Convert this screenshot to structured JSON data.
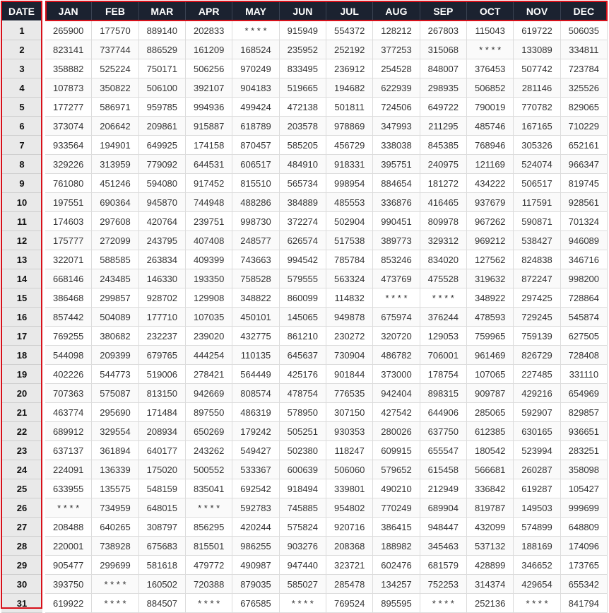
{
  "table": {
    "date_header": "DATE",
    "months": [
      "JAN",
      "FEB",
      "MAR",
      "APR",
      "MAY",
      "JUN",
      "JUL",
      "AUG",
      "SEP",
      "OCT",
      "NOV",
      "DEC"
    ],
    "rows": [
      {
        "date": "1",
        "values": [
          "265900",
          "177570",
          "889140",
          "202833",
          "* * * *",
          "915949",
          "554372",
          "128212",
          "267803",
          "115043",
          "619722",
          "506035"
        ]
      },
      {
        "date": "2",
        "values": [
          "823141",
          "737744",
          "886529",
          "161209",
          "168524",
          "235952",
          "252192",
          "377253",
          "315068",
          "* * * *",
          "133089",
          "334811"
        ]
      },
      {
        "date": "3",
        "values": [
          "358882",
          "525224",
          "750171",
          "506256",
          "970249",
          "833495",
          "236912",
          "254528",
          "848007",
          "376453",
          "507742",
          "723784"
        ]
      },
      {
        "date": "4",
        "values": [
          "107873",
          "350822",
          "506100",
          "392107",
          "904183",
          "519665",
          "194682",
          "622939",
          "298935",
          "506852",
          "281146",
          "325526"
        ]
      },
      {
        "date": "5",
        "values": [
          "177277",
          "586971",
          "959785",
          "994936",
          "499424",
          "472138",
          "501811",
          "724506",
          "649722",
          "790019",
          "770782",
          "829065"
        ]
      },
      {
        "date": "6",
        "values": [
          "373074",
          "206642",
          "209861",
          "915887",
          "618789",
          "203578",
          "978869",
          "347993",
          "211295",
          "485746",
          "167165",
          "710229"
        ]
      },
      {
        "date": "7",
        "values": [
          "933564",
          "194901",
          "649925",
          "174158",
          "870457",
          "585205",
          "456729",
          "338038",
          "845385",
          "768946",
          "305326",
          "652161"
        ]
      },
      {
        "date": "8",
        "values": [
          "329226",
          "313959",
          "779092",
          "644531",
          "606517",
          "484910",
          "918331",
          "395751",
          "240975",
          "121169",
          "524074",
          "966347"
        ]
      },
      {
        "date": "9",
        "values": [
          "761080",
          "451246",
          "594080",
          "917452",
          "815510",
          "565734",
          "998954",
          "884654",
          "181272",
          "434222",
          "506517",
          "819745"
        ]
      },
      {
        "date": "10",
        "values": [
          "197551",
          "690364",
          "945870",
          "744948",
          "488286",
          "384889",
          "485553",
          "336876",
          "416465",
          "937679",
          "117591",
          "928561"
        ]
      },
      {
        "date": "11",
        "values": [
          "174603",
          "297608",
          "420764",
          "239751",
          "998730",
          "372274",
          "502904",
          "990451",
          "809978",
          "967262",
          "590871",
          "701324"
        ]
      },
      {
        "date": "12",
        "values": [
          "175777",
          "272099",
          "243795",
          "407408",
          "248577",
          "626574",
          "517538",
          "389773",
          "329312",
          "969212",
          "538427",
          "946089"
        ]
      },
      {
        "date": "13",
        "values": [
          "322071",
          "588585",
          "263834",
          "409399",
          "743663",
          "994542",
          "785784",
          "853246",
          "834020",
          "127562",
          "824838",
          "346716"
        ]
      },
      {
        "date": "14",
        "values": [
          "668146",
          "243485",
          "146330",
          "193350",
          "758528",
          "579555",
          "563324",
          "473769",
          "475528",
          "319632",
          "872247",
          "998200"
        ]
      },
      {
        "date": "15",
        "values": [
          "386468",
          "299857",
          "928702",
          "129908",
          "348822",
          "860099",
          "114832",
          "* * * *",
          "* * * *",
          "348922",
          "297425",
          "728864"
        ]
      },
      {
        "date": "16",
        "values": [
          "857442",
          "504089",
          "177710",
          "107035",
          "450101",
          "145065",
          "949878",
          "675974",
          "376244",
          "478593",
          "729245",
          "545874"
        ]
      },
      {
        "date": "17",
        "values": [
          "769255",
          "380682",
          "232237",
          "239020",
          "432775",
          "861210",
          "230272",
          "320720",
          "129053",
          "759965",
          "759139",
          "627505"
        ]
      },
      {
        "date": "18",
        "values": [
          "544098",
          "209399",
          "679765",
          "444254",
          "110135",
          "645637",
          "730904",
          "486782",
          "706001",
          "961469",
          "826729",
          "728408"
        ]
      },
      {
        "date": "19",
        "values": [
          "402226",
          "544773",
          "519006",
          "278421",
          "564449",
          "425176",
          "901844",
          "373000",
          "178754",
          "107065",
          "227485",
          "331110"
        ]
      },
      {
        "date": "20",
        "values": [
          "707363",
          "575087",
          "813150",
          "942669",
          "808574",
          "478754",
          "776535",
          "942404",
          "898315",
          "909787",
          "429216",
          "654969"
        ]
      },
      {
        "date": "21",
        "values": [
          "463774",
          "295690",
          "171484",
          "897550",
          "486319",
          "578950",
          "307150",
          "427542",
          "644906",
          "285065",
          "592907",
          "829857"
        ]
      },
      {
        "date": "22",
        "values": [
          "689912",
          "329554",
          "208934",
          "650269",
          "179242",
          "505251",
          "930353",
          "280026",
          "637750",
          "612385",
          "630165",
          "936651"
        ]
      },
      {
        "date": "23",
        "values": [
          "637137",
          "361894",
          "640177",
          "243262",
          "549427",
          "502380",
          "118247",
          "609915",
          "655547",
          "180542",
          "523994",
          "283251"
        ]
      },
      {
        "date": "24",
        "values": [
          "224091",
          "136339",
          "175020",
          "500552",
          "533367",
          "600639",
          "506060",
          "579652",
          "615458",
          "566681",
          "260287",
          "358098"
        ]
      },
      {
        "date": "25",
        "values": [
          "633955",
          "135575",
          "548159",
          "835041",
          "692542",
          "918494",
          "339801",
          "490210",
          "212949",
          "336842",
          "619287",
          "105427"
        ]
      },
      {
        "date": "26",
        "values": [
          "* * * *",
          "734959",
          "648015",
          "* * * *",
          "592783",
          "745885",
          "954802",
          "770249",
          "689904",
          "819787",
          "149503",
          "999699"
        ]
      },
      {
        "date": "27",
        "values": [
          "208488",
          "640265",
          "308797",
          "856295",
          "420244",
          "575824",
          "920716",
          "386415",
          "948447",
          "432099",
          "574899",
          "648809"
        ]
      },
      {
        "date": "28",
        "values": [
          "220001",
          "738928",
          "675683",
          "815501",
          "986255",
          "903276",
          "208368",
          "188982",
          "345463",
          "537132",
          "188169",
          "174096"
        ]
      },
      {
        "date": "29",
        "values": [
          "905477",
          "299699",
          "581618",
          "479772",
          "490987",
          "947440",
          "323721",
          "602476",
          "681579",
          "428899",
          "346652",
          "173765"
        ]
      },
      {
        "date": "30",
        "values": [
          "393750",
          "* * * *",
          "160502",
          "720388",
          "879035",
          "585027",
          "285478",
          "134257",
          "752253",
          "314374",
          "429654",
          "655342"
        ]
      },
      {
        "date": "31",
        "values": [
          "619922",
          "* * * *",
          "884507",
          "* * * *",
          "676585",
          "* * * *",
          "769524",
          "895595",
          "* * * *",
          "252136",
          "* * * *",
          "841794"
        ]
      }
    ]
  },
  "colors": {
    "header_bg": "#1b2230",
    "header_text": "#ffffff",
    "date_col_bg": "#e9e9e9",
    "highlight_border": "#d7101a"
  }
}
